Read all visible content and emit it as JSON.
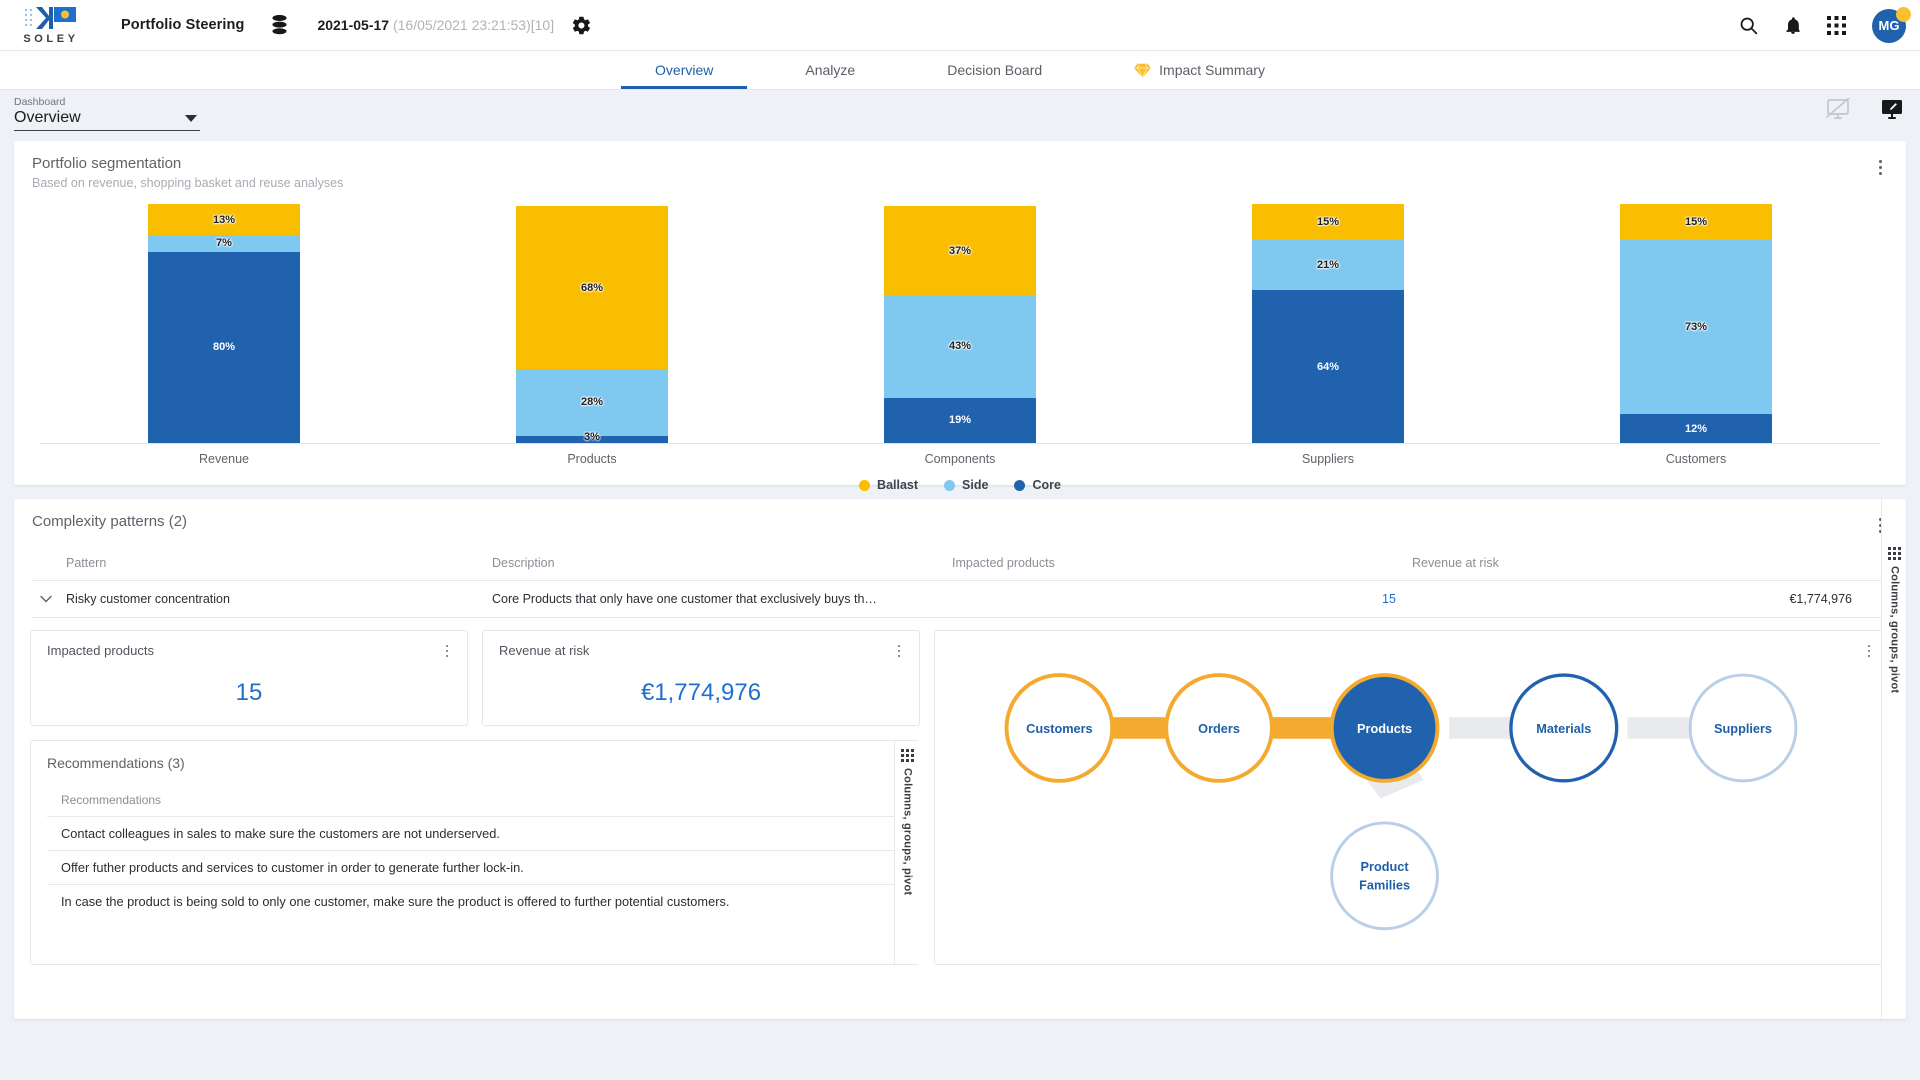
{
  "topbar": {
    "logo_text": "SOLEY",
    "app_title": "Portfolio Steering",
    "database_icon": "database-icon",
    "date_primary": "2021-05-17",
    "date_secondary": "(16/05/2021 23:21:53)[10]",
    "gear_icon": "gear-icon",
    "search_icon": "search-icon",
    "bell_icon": "notification-bell-icon",
    "apps_icon": "apps-grid-icon",
    "avatar_initials": "MG",
    "accent_blue": "#2062ad",
    "accent_yellow": "#fbc02d"
  },
  "nav": {
    "tabs": [
      {
        "label": "Overview",
        "active": true
      },
      {
        "label": "Analyze",
        "active": false
      },
      {
        "label": "Decision Board",
        "active": false
      },
      {
        "label": "Impact Summary",
        "active": false,
        "icon": "gem-icon"
      }
    ]
  },
  "dashboard_select": {
    "label": "Dashboard",
    "value": "Overview",
    "caret_icon": "chevron-down-icon"
  },
  "dashboard_actions": {
    "present_off_icon": "monitor-off-icon",
    "edit_screen_icon": "monitor-edit-icon"
  },
  "segmentation_panel": {
    "title": "Portfolio segmentation",
    "subtitle": "Based on revenue, shopping basket and reuse analyses",
    "menu_icon": "more-vertical-icon"
  },
  "chart_data": {
    "type": "bar",
    "title": "Portfolio segmentation",
    "subtitle": "Based on revenue, shopping basket and reuse analyses",
    "stacked": true,
    "normalized_percent": true,
    "xlabel": "",
    "ylabel": "",
    "ylim": [
      0,
      100
    ],
    "grid": false,
    "legend_position": "bottom",
    "categories": [
      "Revenue",
      "Products",
      "Components",
      "Suppliers",
      "Customers"
    ],
    "series": [
      {
        "name": "Ballast",
        "color": "#f9be00",
        "values": [
          13,
          68,
          37,
          15,
          15
        ]
      },
      {
        "name": "Side",
        "color": "#7fc8f0",
        "values": [
          7,
          28,
          43,
          21,
          73
        ]
      },
      {
        "name": "Core",
        "color": "#2062ad",
        "values": [
          80,
          3,
          19,
          64,
          12
        ]
      }
    ],
    "value_labels": [
      "13%",
      "7%",
      "80%",
      "68%",
      "28%",
      "3%",
      "37%",
      "43%",
      "19%",
      "15%",
      "21%",
      "64%",
      "15%",
      "73%",
      "12%"
    ]
  },
  "patterns_panel": {
    "title": "Complexity patterns (2)",
    "menu_icon": "more-vertical-icon",
    "columns": [
      "Pattern",
      "Description",
      "Impacted products",
      "Revenue at risk"
    ],
    "rows": [
      {
        "expander_icon": "chevron-down-icon",
        "pattern": "Risky customer concentration",
        "description": "Core Products that only have one customer that exclusively buys th…",
        "impacted_products": "15",
        "revenue_at_risk": "€1,774,976"
      }
    ],
    "side_handle": "Columns, groups, pivot"
  },
  "detail": {
    "kpis": [
      {
        "title": "Impacted products",
        "value": "15",
        "menu_icon": "more-vertical-icon"
      },
      {
        "title": "Revenue at risk",
        "value": "€1,774,976",
        "menu_icon": "more-vertical-icon"
      }
    ],
    "recommendations": {
      "title": "Recommendations (3)",
      "column_header": "Recommendations",
      "menu_icon": "more-vertical-icon",
      "items": [
        "Contact colleagues in sales to make sure the customers are not underserved.",
        "Offer futher products and services to customer in order to generate further lock-in.",
        "In case the product is being sold to only one customer, make sure the product is offered to further potential customers."
      ],
      "side_handle": "Columns, groups, pivot"
    },
    "graph": {
      "menu_icon": "more-vertical-icon",
      "nodes": [
        {
          "id": "customers",
          "label": "Customers",
          "state": "highlight-orange"
        },
        {
          "id": "orders",
          "label": "Orders",
          "state": "highlight-orange"
        },
        {
          "id": "products",
          "label": "Products",
          "state": "selected-blue"
        },
        {
          "id": "materials",
          "label": "Materials",
          "state": "outline-blue"
        },
        {
          "id": "suppliers",
          "label": "Suppliers",
          "state": "outline-light"
        },
        {
          "id": "product-families",
          "label": "Product\nFamilies",
          "label_line1": "Product",
          "label_line2": "Families",
          "state": "outline-light"
        }
      ],
      "links": [
        {
          "from": "customers",
          "to": "orders",
          "state": "active-orange"
        },
        {
          "from": "orders",
          "to": "products",
          "state": "active-orange"
        },
        {
          "from": "products",
          "to": "materials",
          "state": "inactive-grey"
        },
        {
          "from": "materials",
          "to": "suppliers",
          "state": "inactive-grey"
        },
        {
          "from": "products",
          "to": "product-families",
          "state": "inactive-grey"
        }
      ]
    }
  }
}
